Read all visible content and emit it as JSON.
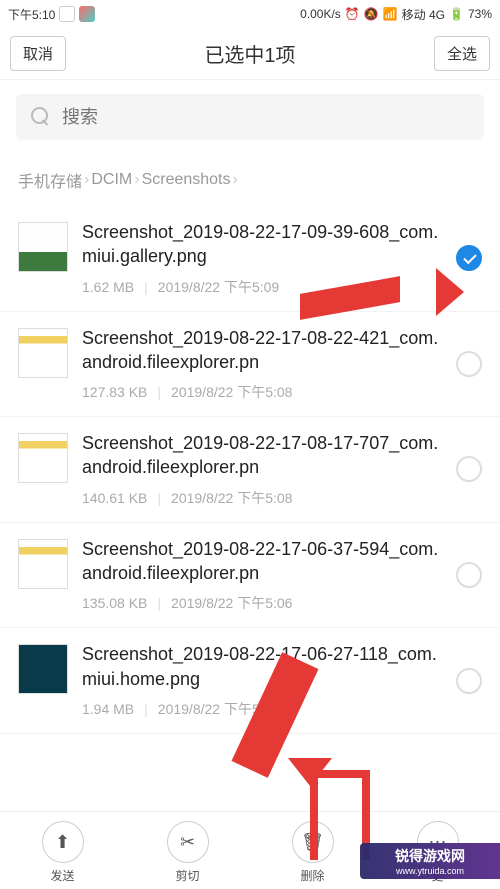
{
  "status": {
    "time": "下午5:10",
    "net_speed": "0.00K/s",
    "carrier": "移动 4G",
    "battery": "73%"
  },
  "header": {
    "cancel": "取消",
    "title": "已选中1项",
    "select_all": "全选"
  },
  "search": {
    "placeholder": "搜索"
  },
  "breadcrumbs": {
    "a": "手机存储",
    "b": "DCIM",
    "c": "Screenshots"
  },
  "files": [
    {
      "name": "Screenshot_2019-08-22-17-09-39-608_com.miui.gallery.png",
      "size": "1.62 MB",
      "date": "2019/8/22 下午5:09",
      "checked": true,
      "thumb": "gallery"
    },
    {
      "name": "Screenshot_2019-08-22-17-08-22-421_com.android.fileexplorer.pn",
      "size": "127.83 KB",
      "date": "2019/8/22 下午5:08",
      "checked": false,
      "thumb": "fe"
    },
    {
      "name": "Screenshot_2019-08-22-17-08-17-707_com.android.fileexplorer.pn",
      "size": "140.61 KB",
      "date": "2019/8/22 下午5:08",
      "checked": false,
      "thumb": "fe"
    },
    {
      "name": "Screenshot_2019-08-22-17-06-37-594_com.android.fileexplorer.pn",
      "size": "135.08 KB",
      "date": "2019/8/22 下午5:06",
      "checked": false,
      "thumb": "fe"
    },
    {
      "name": "Screenshot_2019-08-22-17-06-27-118_com.miui.home.png",
      "size": "1.94 MB",
      "date": "2019/8/22 下午5:06",
      "checked": false,
      "thumb": "home"
    }
  ],
  "actions": {
    "send": "发送",
    "cut": "剪切",
    "delete": "删除",
    "more": "更"
  },
  "watermark": {
    "main": "锐得游戏网",
    "sub": "www.ytruida.com"
  }
}
